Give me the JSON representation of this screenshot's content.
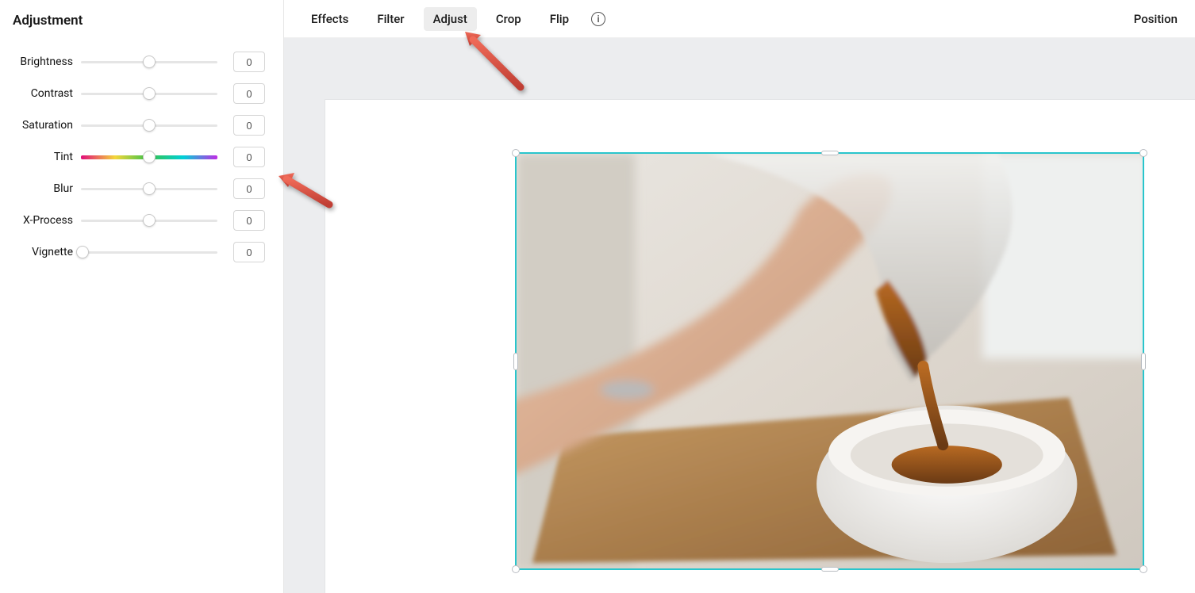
{
  "sidebar": {
    "title": "Adjustment",
    "items": [
      {
        "label": "Brightness",
        "value": "0",
        "thumb": 50,
        "track": "plain"
      },
      {
        "label": "Contrast",
        "value": "0",
        "thumb": 50,
        "track": "plain"
      },
      {
        "label": "Saturation",
        "value": "0",
        "thumb": 50,
        "track": "plain"
      },
      {
        "label": "Tint",
        "value": "0",
        "thumb": 50,
        "track": "tint"
      },
      {
        "label": "Blur",
        "value": "0",
        "thumb": 50,
        "track": "plain"
      },
      {
        "label": "X-Process",
        "value": "0",
        "thumb": 50,
        "track": "plain"
      },
      {
        "label": "Vignette",
        "value": "0",
        "thumb": 0,
        "track": "plain"
      }
    ]
  },
  "toolbar": {
    "items": [
      {
        "label": "Effects",
        "active": false
      },
      {
        "label": "Filter",
        "active": false
      },
      {
        "label": "Adjust",
        "active": true
      },
      {
        "label": "Crop",
        "active": false
      },
      {
        "label": "Flip",
        "active": false
      }
    ],
    "info_icon": "info-icon",
    "right": "Position"
  },
  "canvas": {
    "selected_image_alt": "Hand pouring coffee from a glass carafe into a white cup on a wooden board"
  },
  "annotations": {
    "arrow_color": "#d94b3f"
  }
}
